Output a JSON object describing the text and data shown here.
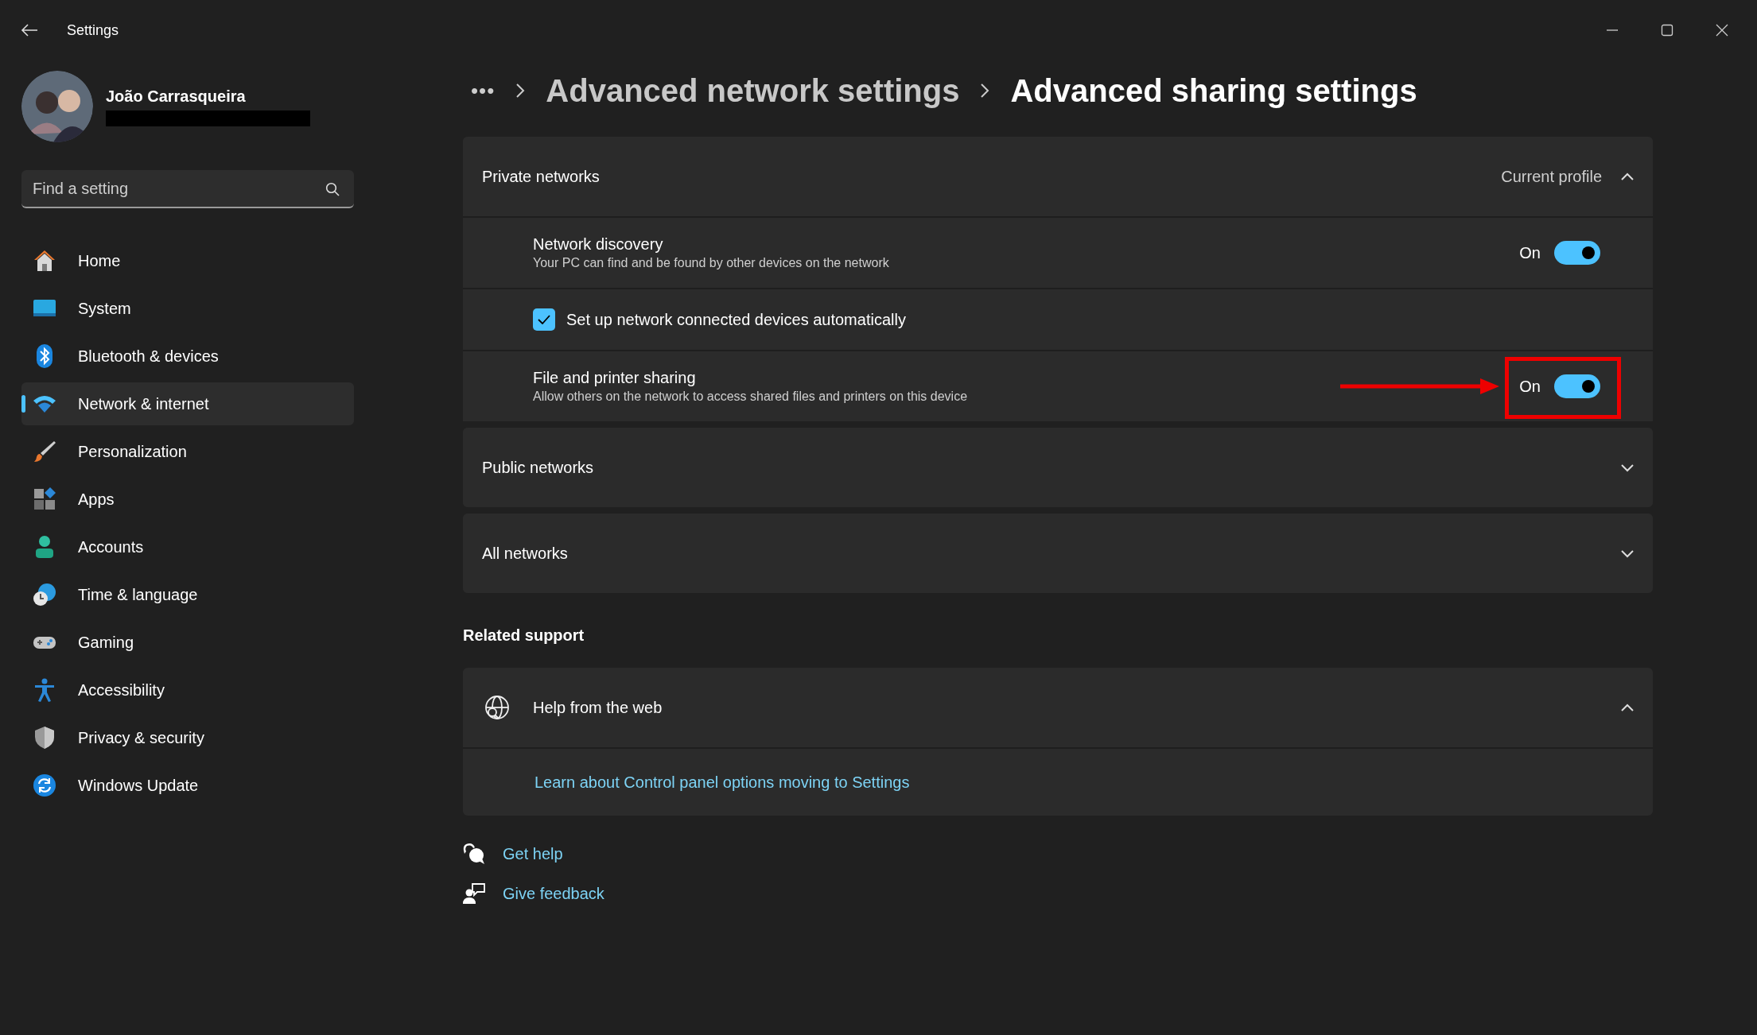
{
  "window": {
    "title": "Settings"
  },
  "user": {
    "name": "João Carrasqueira"
  },
  "search": {
    "placeholder": "Find a setting"
  },
  "nav": [
    {
      "kind": "home",
      "label": "Home",
      "selected": false
    },
    {
      "kind": "system",
      "label": "System",
      "selected": false
    },
    {
      "kind": "bluetooth",
      "label": "Bluetooth & devices",
      "selected": false
    },
    {
      "kind": "network",
      "label": "Network & internet",
      "selected": true
    },
    {
      "kind": "personalization",
      "label": "Personalization",
      "selected": false
    },
    {
      "kind": "apps",
      "label": "Apps",
      "selected": false
    },
    {
      "kind": "accounts",
      "label": "Accounts",
      "selected": false
    },
    {
      "kind": "time",
      "label": "Time & language",
      "selected": false
    },
    {
      "kind": "gaming",
      "label": "Gaming",
      "selected": false
    },
    {
      "kind": "accessibility",
      "label": "Accessibility",
      "selected": false
    },
    {
      "kind": "privacy",
      "label": "Privacy & security",
      "selected": false
    },
    {
      "kind": "update",
      "label": "Windows Update",
      "selected": false
    }
  ],
  "breadcrumb": {
    "overflow": "•••",
    "items": [
      "Advanced network settings",
      "Advanced sharing settings"
    ]
  },
  "sections": [
    {
      "title": "Private networks",
      "status": "Current profile",
      "expanded": true,
      "rows": [
        {
          "kind": "toggle",
          "title": "Network discovery",
          "description": "Your PC can find and be found by other devices on the network",
          "state_label": "On",
          "on": true,
          "annotated": false
        },
        {
          "kind": "checkbox",
          "label": "Set up network connected devices automatically",
          "checked": true
        },
        {
          "kind": "toggle",
          "title": "File and printer sharing",
          "description": "Allow others on the network to access shared files and printers on this device",
          "state_label": "On",
          "on": true,
          "annotated": true
        }
      ]
    },
    {
      "title": "Public networks",
      "expanded": false
    },
    {
      "title": "All networks",
      "expanded": false
    }
  ],
  "related_support": {
    "heading": "Related support",
    "title": "Help from the web",
    "expanded": true,
    "links": [
      "Learn about Control panel options moving to Settings"
    ]
  },
  "footer_links": [
    {
      "kind": "help",
      "label": "Get help"
    },
    {
      "kind": "feedback",
      "label": "Give feedback"
    }
  ]
}
